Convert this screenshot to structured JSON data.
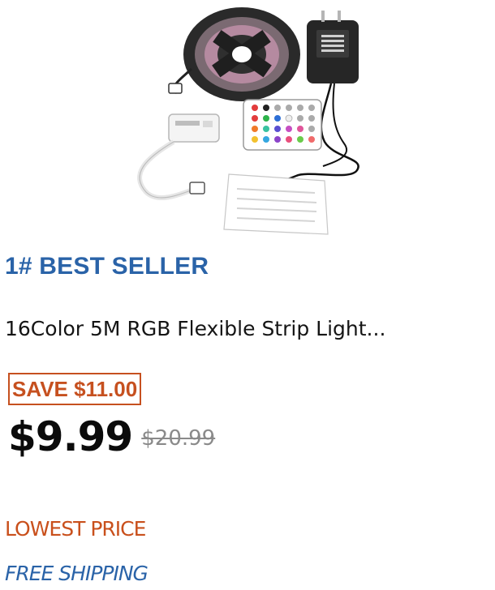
{
  "product": {
    "image_alt": "16Color 5M RGB Flexible Strip Light kit with remote, controller and power adapter",
    "badge": "1# BEST SELLER",
    "title": "16Color 5M RGB Flexible Strip Light...",
    "save_label": "SAVE $11.00",
    "price": "$9.99",
    "original_price": "$20.99",
    "lowest_price_label": "LOWEST PRICE",
    "shipping_label": "FREE SHIPPING"
  },
  "colors": {
    "badge_blue": "#2a63a8",
    "save_orange": "#c6501f",
    "lowest_price_orange": "#c9501c",
    "price_black": "#0b0b0b",
    "strike_gray": "#8a8a8a"
  },
  "icons": {
    "product_image": "led-strip-kit-image"
  }
}
